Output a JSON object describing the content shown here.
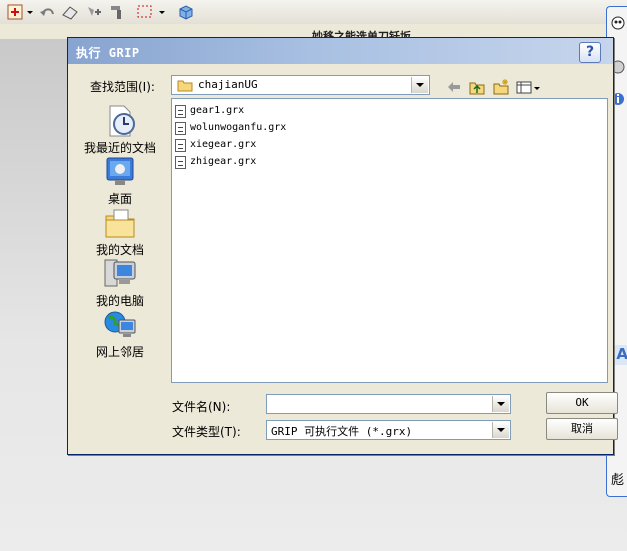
{
  "background": {
    "title_text": "妙移之能选单刀钎坂",
    "side_panel_bottom_text": "彪"
  },
  "dialog": {
    "title": "执行 GRIP",
    "help_label": "?",
    "look_in_label": "查找范围(I):",
    "look_in_value": "chajianUG",
    "places": [
      {
        "label": "我最近的文档",
        "icon": "recent-documents-icon"
      },
      {
        "label": "桌面",
        "icon": "desktop-icon"
      },
      {
        "label": "我的文档",
        "icon": "my-documents-icon"
      },
      {
        "label": "我的电脑",
        "icon": "my-computer-icon"
      },
      {
        "label": "网上邻居",
        "icon": "network-places-icon"
      }
    ],
    "files": [
      "gear1.grx",
      "wolunwoganfu.grx",
      "xiegear.grx",
      "zhigear.grx"
    ],
    "filename_label": "文件名(N):",
    "filename_value": "",
    "filetype_label": "文件类型(T):",
    "filetype_value": "GRIP 可执行文件 (*.grx)",
    "ok_label": "OK",
    "cancel_label": "取消"
  },
  "colors": {
    "title_bar_start": "#87a3cf",
    "title_bar_end": "#c6d5ec",
    "dialog_bg": "#ece9d8",
    "input_border": "#7f9db9"
  }
}
